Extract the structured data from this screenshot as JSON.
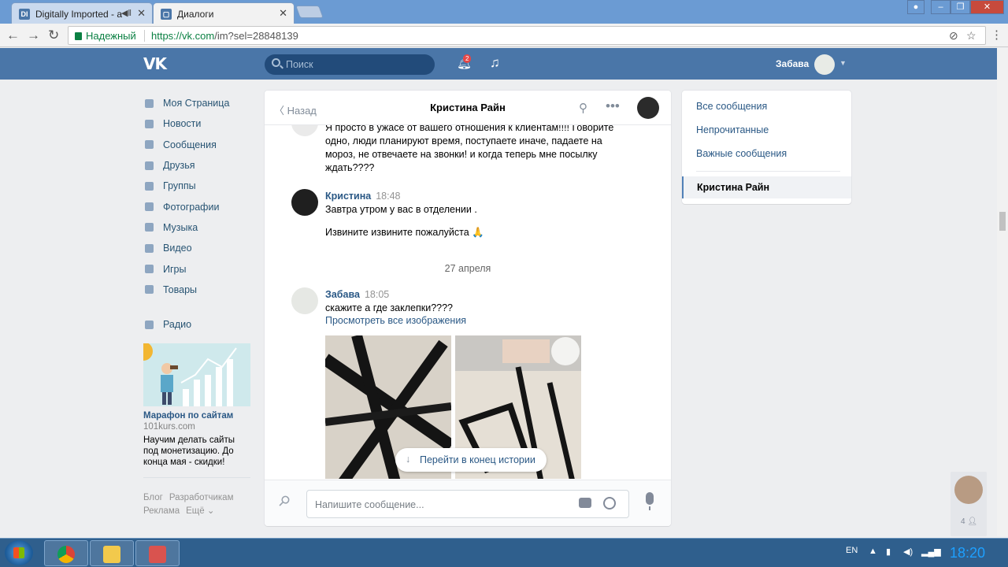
{
  "browser": {
    "tabs": [
      {
        "title": "Digitally Imported - a",
        "active": false
      },
      {
        "title": "Диалоги",
        "active": true
      }
    ],
    "secure_label": "Надежный",
    "url_host": "https://vk.com",
    "url_path": "/im?sel=28848139"
  },
  "header": {
    "logo": "VK",
    "search_placeholder": "Поиск",
    "notification_count": "2",
    "user_name": "Забава"
  },
  "sidebar": {
    "items": [
      {
        "label": "Моя Страница",
        "icon": "home-icon"
      },
      {
        "label": "Новости",
        "icon": "news-icon"
      },
      {
        "label": "Сообщения",
        "icon": "messages-icon"
      },
      {
        "label": "Друзья",
        "icon": "friends-icon"
      },
      {
        "label": "Группы",
        "icon": "groups-icon"
      },
      {
        "label": "Фотографии",
        "icon": "camera-icon"
      },
      {
        "label": "Музыка",
        "icon": "music-icon"
      },
      {
        "label": "Видео",
        "icon": "video-icon"
      },
      {
        "label": "Игры",
        "icon": "games-icon"
      },
      {
        "label": "Товары",
        "icon": "bag-icon"
      }
    ],
    "extra": {
      "label": "Радио",
      "icon": "radio-icon"
    },
    "promo": {
      "title": "Марафон по сайтам",
      "domain": "101kurs.com",
      "text": "Научим делать сайты под монетизацию. До конца мая - скидки!"
    },
    "footer": [
      "Блог",
      "Разработчикам",
      "Реклама",
      "Ещё ⌄"
    ]
  },
  "chat": {
    "back_label": "Назад",
    "title": "Кристина Райн",
    "messages": {
      "partial_text": "Я просто в ужасе от вашего отношения к клиентам!!!! Говорите одно, люди планируют время, поступаете иначе, падаете на мороз, не отвечаете на звонки! и когда теперь мне посылку ждать????",
      "m1_author": "Кристина",
      "m1_time": "18:48",
      "m1_line1": "Завтра утром у вас в отделении .",
      "m1_line2": "Извините извините пожалуйста 🙏",
      "date_divider": "27 апреля",
      "m2_author": "Забава",
      "m2_time": "18:05",
      "m2_text": "скажите а где заклепки????",
      "m2_link": "Просмотреть все изображения"
    },
    "jump_label": "Перейти в конец истории",
    "composer_placeholder": "Напишите сообщение..."
  },
  "filters": {
    "items": [
      "Все сообщения",
      "Непрочитанные",
      "Важные сообщения"
    ],
    "active": "Кристина Райн"
  },
  "chat_fab": {
    "count": "4"
  },
  "taskbar": {
    "lang": "EN",
    "clock": "18:20"
  }
}
